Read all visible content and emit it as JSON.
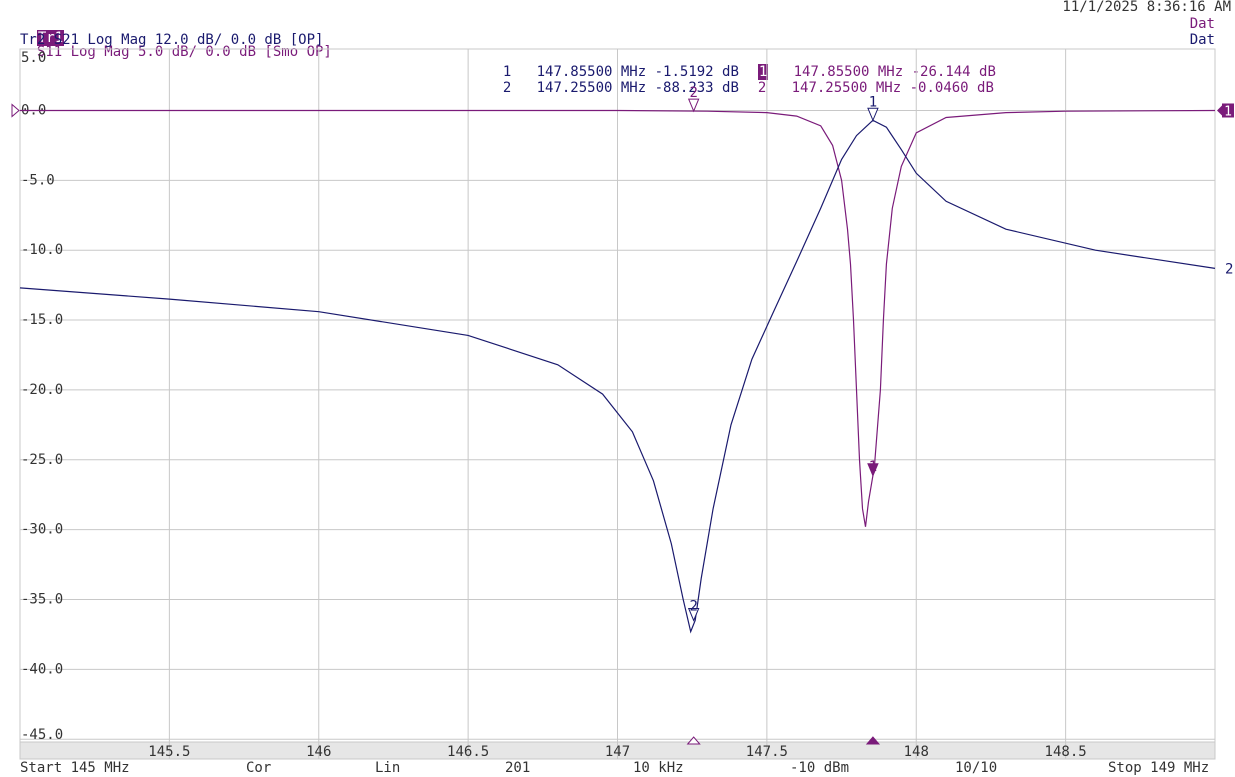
{
  "header": {
    "datetime": "11/1/2025 8:36:16 AM",
    "tr1_badge": "Tr1",
    "tr1_text": "S11 Log Mag 5.0 dB/ 0.0 dB [Smo OP]",
    "tr2_text": "Tr2 S21 Log Mag 12.0 dB/ 0.0 dB [OP]",
    "dat1": "Dat",
    "dat2": "Dat"
  },
  "marker_table": {
    "col1": [
      {
        "idx": "1",
        "freq": "147.85500 MHz",
        "val": "-1.5192 dB"
      },
      {
        "idx": "2",
        "freq": "147.25500 MHz",
        "val": "-88.233 dB"
      }
    ],
    "col2": [
      {
        "idx": "1",
        "freq": "147.85500 MHz",
        "val": "-26.144 dB"
      },
      {
        "idx": "2",
        "freq": "147.25500 MHz",
        "val": "-0.0460 dB"
      }
    ]
  },
  "footer": {
    "start": "Start 145 MHz",
    "cor": "Cor",
    "lin": "Lin",
    "points": "201",
    "ifbw": "10 kHz",
    "power": "-10 dBm",
    "avg": "10/10",
    "stop": "Stop 149 MHz"
  },
  "colors": {
    "s11": "#7a1b7a",
    "s21": "#1a1a6e",
    "grid": "#c8c8c8",
    "ticks_band": "#e6e6e6"
  },
  "chart_data": {
    "type": "line",
    "title": "",
    "xlabel": "",
    "ylabel": "",
    "xlim": [
      145,
      149
    ],
    "ylim": [
      -45,
      5
    ],
    "x_tick_labels": [
      "145.5",
      "146",
      "146.5",
      "147",
      "147.5",
      "148",
      "148.5"
    ],
    "x_ticks": [
      145.5,
      146,
      146.5,
      147,
      147.5,
      148,
      148.5
    ],
    "y_tick_labels": [
      "5.0",
      "0.0",
      "-5.0",
      "-10.0",
      "-15.0",
      "-20.0",
      "-25.0",
      "-30.0",
      "-35.0",
      "-40.0",
      "-45.0"
    ],
    "y_ticks": [
      5,
      0,
      -5,
      -10,
      -15,
      -20,
      -25,
      -30,
      -35,
      -40,
      -45
    ],
    "grid": true,
    "series": [
      {
        "name": "S11",
        "color": "#7a1b7a",
        "x": [
          145.0,
          146.0,
          147.0,
          147.3,
          147.5,
          147.6,
          147.68,
          147.72,
          147.75,
          147.77,
          147.78,
          147.79,
          147.8,
          147.81,
          147.82,
          147.83,
          147.84,
          147.86,
          147.88,
          147.89,
          147.9,
          147.92,
          147.95,
          148.0,
          148.1,
          148.3,
          148.5,
          149.0
        ],
        "y": [
          0.0,
          0.0,
          0.0,
          -0.05,
          -0.15,
          -0.4,
          -1.1,
          -2.5,
          -5.0,
          -8.5,
          -11.0,
          -15.0,
          -20.0,
          -25.0,
          -28.5,
          -29.8,
          -28.0,
          -25.5,
          -20.0,
          -15.0,
          -11.0,
          -7.0,
          -4.0,
          -1.6,
          -0.5,
          -0.15,
          -0.05,
          0.0
        ]
      },
      {
        "name": "S21",
        "color": "#1a1a6e",
        "x": [
          145.0,
          145.5,
          146.0,
          146.5,
          146.8,
          146.95,
          147.05,
          147.12,
          147.18,
          147.22,
          147.245,
          147.26,
          147.28,
          147.32,
          147.38,
          147.45,
          147.52,
          147.6,
          147.68,
          147.75,
          147.8,
          147.855,
          147.9,
          147.95,
          148.0,
          148.1,
          148.3,
          148.6,
          149.0
        ],
        "y": [
          -12.7,
          -13.5,
          -14.4,
          -16.1,
          -18.2,
          -20.3,
          -23.0,
          -26.5,
          -31.0,
          -35.0,
          -37.3,
          -36.5,
          -33.5,
          -28.5,
          -22.5,
          -17.8,
          -14.5,
          -10.8,
          -7.0,
          -3.5,
          -1.8,
          -0.7,
          -1.2,
          -2.8,
          -4.5,
          -6.5,
          -8.5,
          -10.0,
          -11.3
        ]
      }
    ],
    "markers": [
      {
        "trace": "S11",
        "label": "1",
        "x": 147.855,
        "y": -26.144
      },
      {
        "trace": "S11",
        "label": "2",
        "x": 147.255,
        "y": -0.046
      },
      {
        "trace": "S21",
        "label": "1",
        "x": 147.855,
        "y": -1.5192
      },
      {
        "trace": "S21",
        "label": "2",
        "x": 147.255,
        "y": -88.233
      }
    ],
    "trace_end_labels": {
      "s11": "1",
      "s21": "2"
    }
  }
}
